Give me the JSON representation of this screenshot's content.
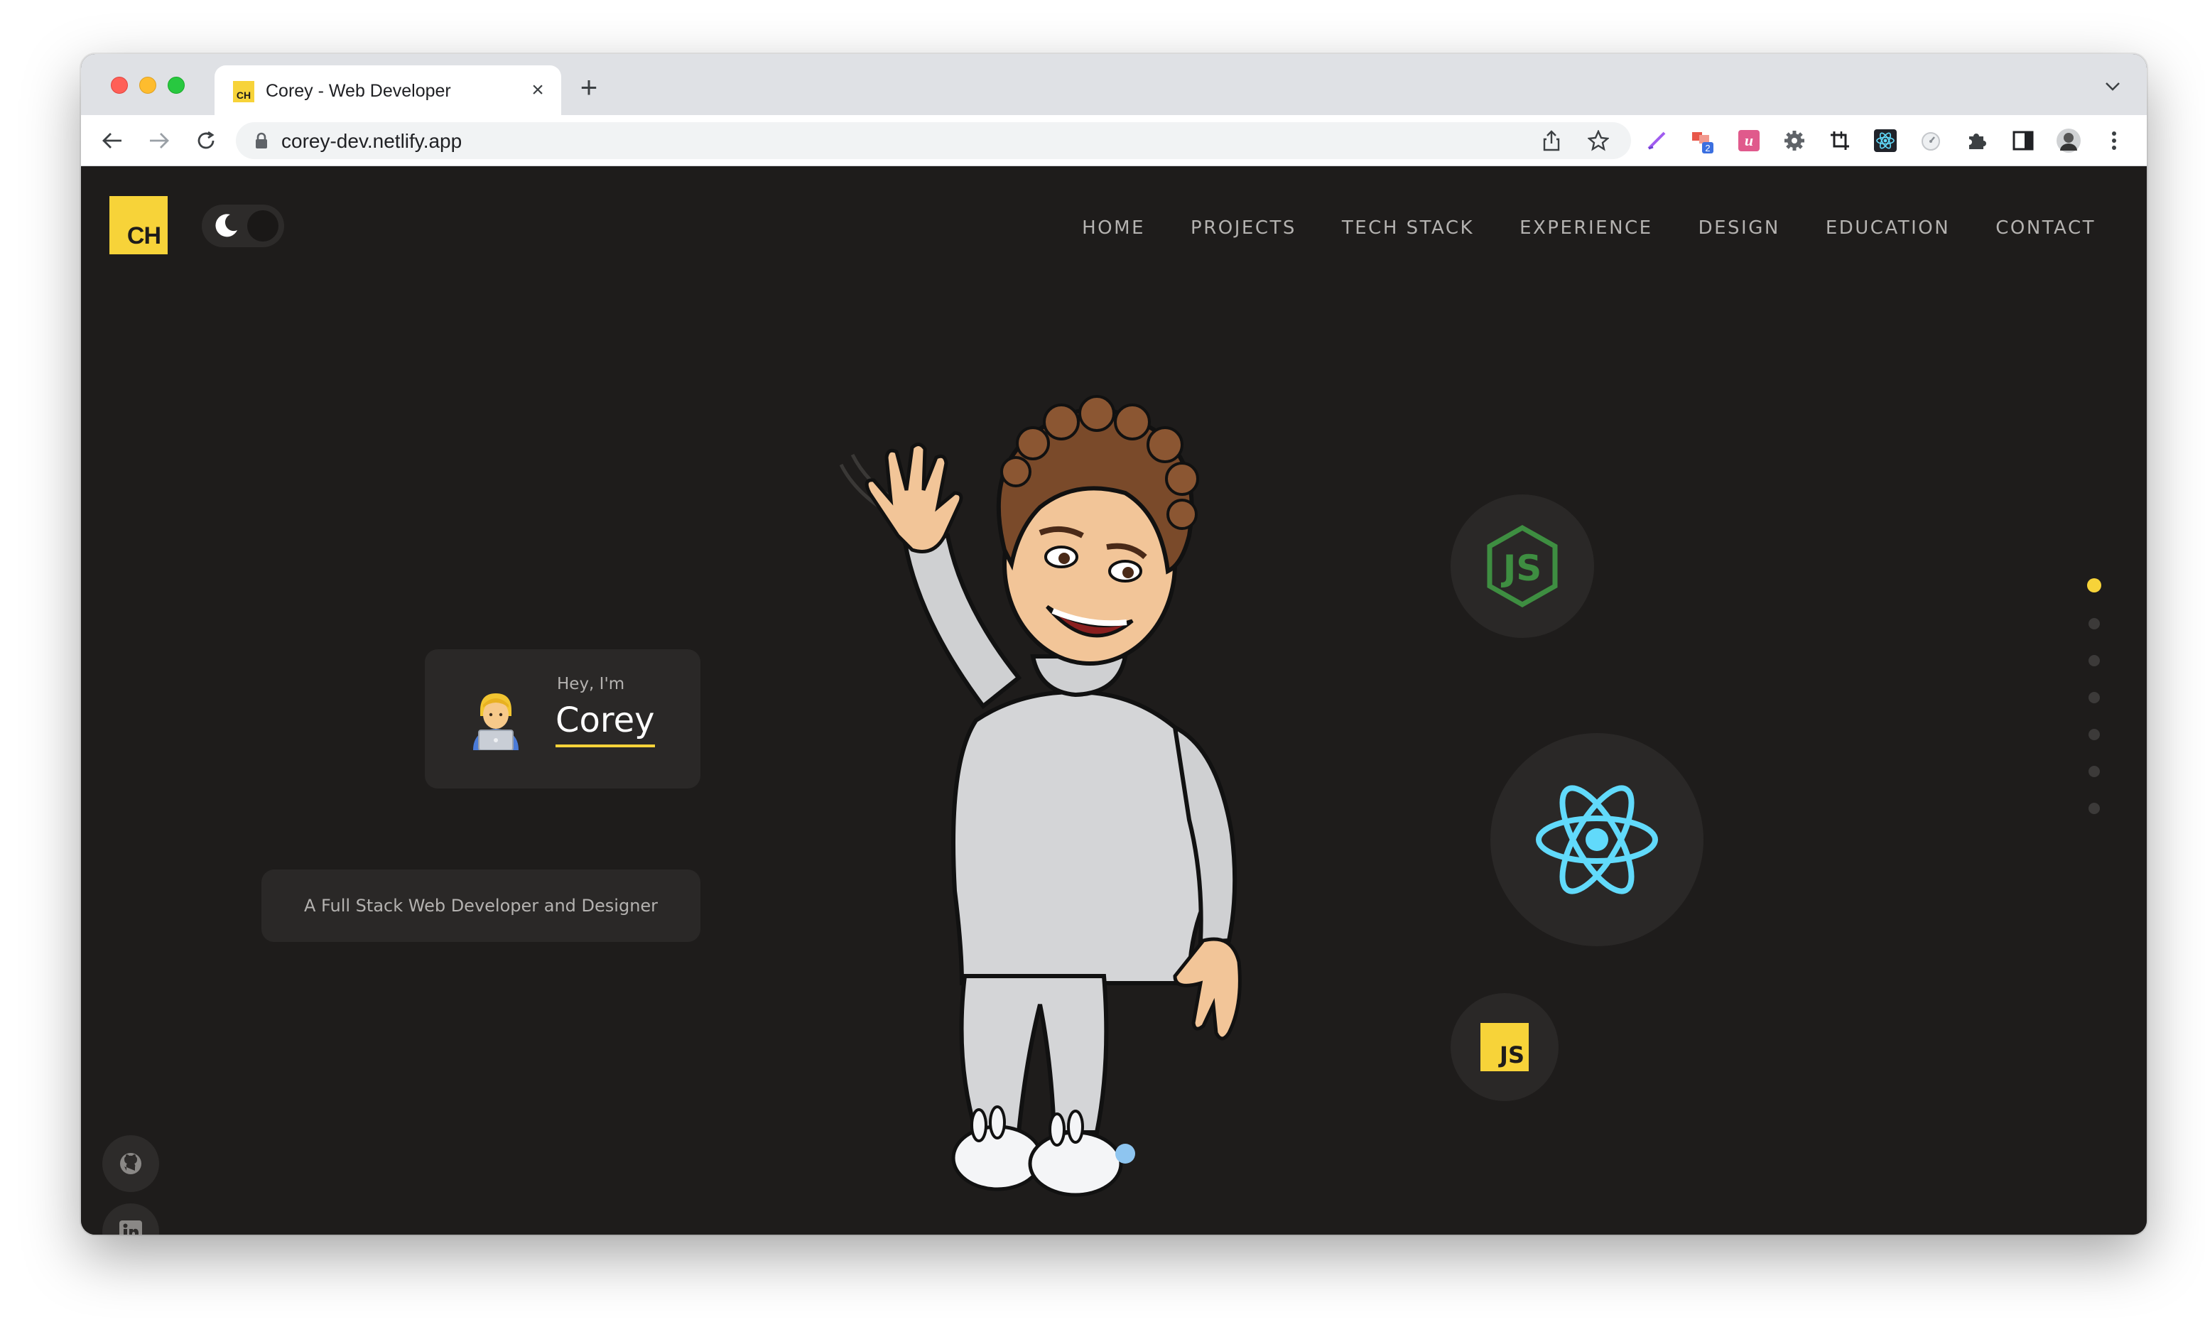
{
  "browser": {
    "tab_title": "Corey - Web Developer",
    "tab_favicon_text": "CH",
    "new_tab_label": "+",
    "close_label": "×",
    "url": "corey-dev.netlify.app",
    "extension_badge": "2",
    "colors": {
      "tabstrip": "#dfe1e5",
      "toolbar": "#ffffff",
      "omnibox": "#f1f3f4"
    }
  },
  "site": {
    "logo_text": "CH",
    "nav": [
      "HOME",
      "PROJECTS",
      "TECH STACK",
      "EXPERIENCE",
      "DESIGN",
      "EDUCATION",
      "CONTACT"
    ],
    "intro": {
      "greeting": "Hey, I'm",
      "name": "Corey",
      "tagline": "A Full Stack Web Developer and Designer"
    },
    "tech_icons": [
      "nodejs-icon",
      "react-icon",
      "javascript-icon"
    ],
    "js_badge_text": "JS",
    "section_dots": {
      "count": 7,
      "active_index": 0
    },
    "social": [
      "github-icon",
      "linkedin-icon"
    ],
    "colors": {
      "background": "#1e1c1b",
      "card": "#2a2827",
      "accent": "#f7d339",
      "nav_text": "#b4b2b0",
      "node_green": "#3e8e41",
      "react_blue": "#61dafb"
    }
  }
}
